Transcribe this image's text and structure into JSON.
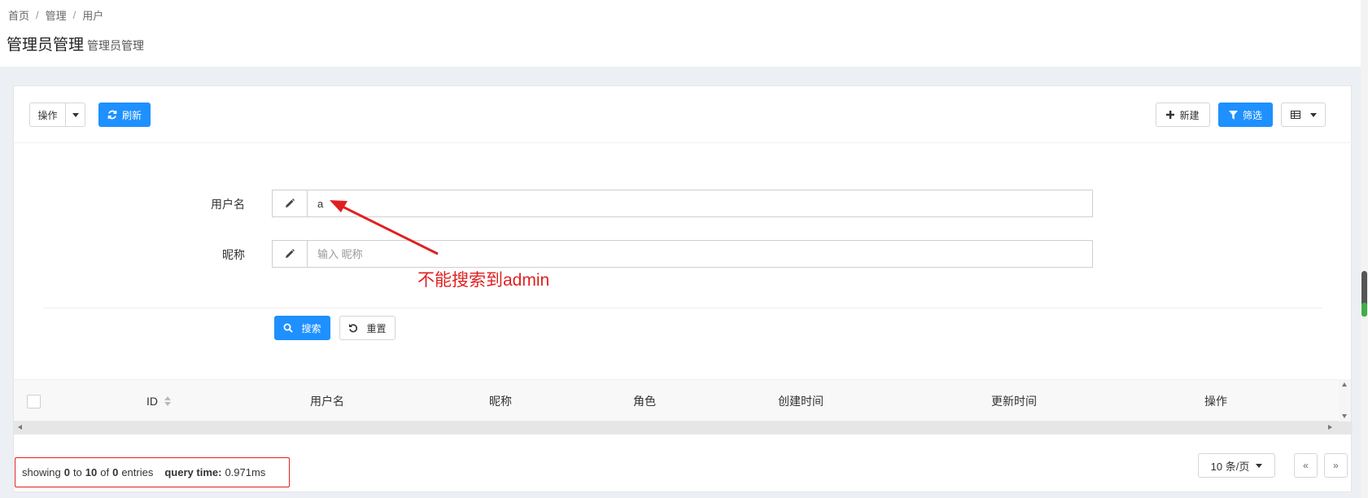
{
  "breadcrumb": [
    "首页",
    "管理",
    "用户"
  ],
  "breadcrumb_separator": "/",
  "page": {
    "title": "管理员管理",
    "subtitle": "管理员管理"
  },
  "toolbar": {
    "actions_label": "操作",
    "refresh_label": "刷新",
    "new_label": "新建",
    "filter_label": "筛选"
  },
  "filter": {
    "username_label": "用户名",
    "username_value": "a",
    "nickname_label": "昵称",
    "nickname_placeholder": "输入 昵称",
    "search_label": "搜索",
    "reset_label": "重置"
  },
  "annotation": {
    "text": "不能搜索到admin",
    "color": "#e02020"
  },
  "table": {
    "columns": [
      "ID",
      "用户名",
      "昵称",
      "角色",
      "创建时间",
      "更新时间",
      "操作"
    ]
  },
  "footer": {
    "showing_prefix": "showing",
    "from": "0",
    "to_word": "to",
    "to": "10",
    "of_word": "of",
    "total": "0",
    "entries_word": "entries",
    "query_time_label": "query time:",
    "query_time_value": "0.971ms",
    "page_size_label": "10 条/页",
    "prev_label": "«",
    "next_label": "»"
  },
  "colors": {
    "primary": "#1e90ff",
    "background": "#ecf0f5",
    "highlight_border": "#e02020"
  },
  "icons": [
    "refresh-icon",
    "plus-icon",
    "filter-icon",
    "table-grid-icon",
    "pencil-icon",
    "search-icon",
    "undo-icon",
    "sort-icon",
    "caret-down-icon"
  ]
}
